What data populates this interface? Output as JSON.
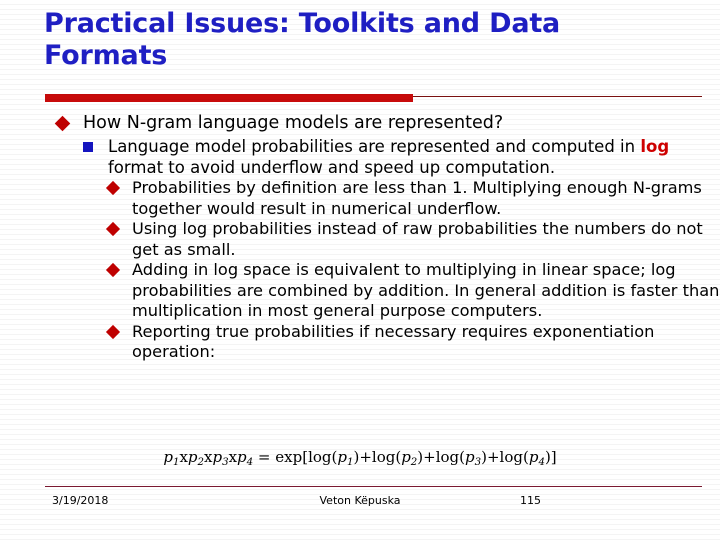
{
  "slide": {
    "title": "Practical Issues: Toolkits and Data Formats",
    "accent_blue": "#1f1fc4",
    "accent_red": "#c80b0b",
    "rule_red": "#7a1010"
  },
  "content": {
    "level1": {
      "marker": "red-diamond",
      "text": "How N-gram language models are represented?"
    },
    "level2": {
      "marker": "blue-square",
      "text_before": "Language model probabilities are represented and computed in ",
      "highlight": "log",
      "highlight_color": "#d00000",
      "text_after": "  format to avoid underflow and speed up computation."
    },
    "level3": [
      {
        "marker": "red-diamond",
        "text": "Probabilities by definition are less than 1. Multiplying enough N-grams together would result in numerical underflow."
      },
      {
        "marker": "red-diamond",
        "text": "Using log probabilities instead of raw probabilities the numbers do not get as small."
      },
      {
        "marker": "red-diamond",
        "text": "Adding in log space is equivalent to multiplying in linear space; log probabilities are combined by addition. In general addition is faster than multiplication in most general purpose computers."
      },
      {
        "marker": "red-diamond",
        "text": "Reporting true probabilities if necessary requires exponentiation operation:"
      }
    ]
  },
  "formula": {
    "plain": "p1xp2xp3xp4 = exp[log(p1)+log(p2)+log(p3)+log(p4)]",
    "lhs_vars": [
      "p",
      "p",
      "p",
      "p"
    ],
    "lhs_subs": [
      "1",
      "2",
      "3",
      "4"
    ],
    "operator_mult": "x",
    "equals": "=",
    "exp_open": "exp[",
    "log_label": "log",
    "plus": "+",
    "close": "]"
  },
  "footer": {
    "date": "3/19/2018",
    "author": "Veton Këpuska",
    "page": "115"
  }
}
